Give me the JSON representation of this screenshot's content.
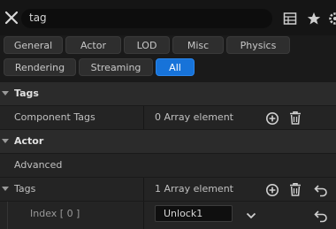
{
  "search": {
    "value": "tag"
  },
  "filters": {
    "row1": [
      "General",
      "Actor",
      "LOD",
      "Misc",
      "Physics"
    ],
    "row2": [
      "Rendering",
      "Streaming",
      "All"
    ],
    "active": "All"
  },
  "colors": {
    "accent": "#1773d9",
    "background": "#1a1a1a",
    "row": "#242424",
    "category": "#2b2b2b"
  },
  "sections": {
    "tags_header": "Tags",
    "component_tags": {
      "label": "Component Tags",
      "value": "0 Array element"
    },
    "actor_header": "Actor",
    "advanced": "Advanced",
    "tags": {
      "label": "Tags",
      "value": "1 Array element"
    },
    "index0": {
      "label": "Index [ 0 ]",
      "value": "Unlock1"
    }
  },
  "icons": [
    "close-icon",
    "table-icon",
    "star-icon",
    "settings-icon",
    "add-icon",
    "delete-icon",
    "reset-icon",
    "chevron-down-icon"
  ]
}
